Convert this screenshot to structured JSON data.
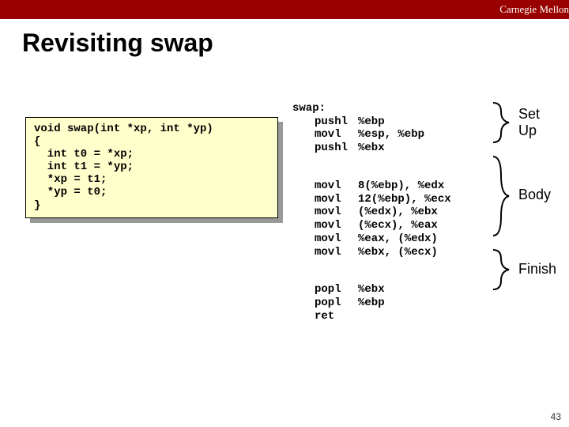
{
  "header": {
    "org": "Carnegie Mellon"
  },
  "title": "Revisiting swap",
  "code": "void swap(int *xp, int *yp)\n{\n  int t0 = *xp;\n  int t1 = *yp;\n  *xp = t1;\n  *yp = t0;\n}",
  "asm": {
    "label": "swap:",
    "setup": [
      {
        "op": "pushl",
        "args": "%ebp"
      },
      {
        "op": "movl",
        "args": "%esp, %ebp"
      },
      {
        "op": "pushl",
        "args": "%ebx"
      }
    ],
    "body": [
      {
        "op": "movl",
        "args": "8(%ebp), %edx"
      },
      {
        "op": "movl",
        "args": "12(%ebp), %ecx"
      },
      {
        "op": "movl",
        "args": "(%edx), %ebx"
      },
      {
        "op": "movl",
        "args": "(%ecx), %eax"
      },
      {
        "op": "movl",
        "args": "%eax, (%edx)"
      },
      {
        "op": "movl",
        "args": "%ebx, (%ecx)"
      }
    ],
    "finish": [
      {
        "op": "popl",
        "args": "%ebx"
      },
      {
        "op": "popl",
        "args": "%ebp"
      },
      {
        "op": "ret",
        "args": ""
      }
    ]
  },
  "annot": {
    "setup_l1": "Set",
    "setup_l2": "Up",
    "body": "Body",
    "finish": "Finish"
  },
  "page": "43"
}
